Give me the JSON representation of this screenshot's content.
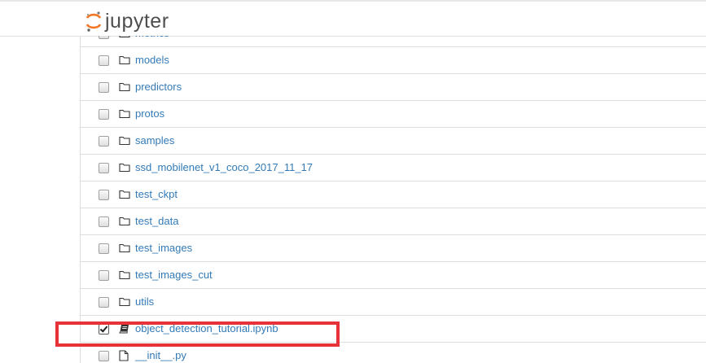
{
  "app": {
    "logo_text": "jupyter"
  },
  "files": [
    {
      "name": "metrics",
      "type": "folder",
      "checked": false
    },
    {
      "name": "models",
      "type": "folder",
      "checked": false
    },
    {
      "name": "predictors",
      "type": "folder",
      "checked": false
    },
    {
      "name": "protos",
      "type": "folder",
      "checked": false
    },
    {
      "name": "samples",
      "type": "folder",
      "checked": false
    },
    {
      "name": "ssd_mobilenet_v1_coco_2017_11_17",
      "type": "folder",
      "checked": false
    },
    {
      "name": "test_ckpt",
      "type": "folder",
      "checked": false
    },
    {
      "name": "test_data",
      "type": "folder",
      "checked": false
    },
    {
      "name": "test_images",
      "type": "folder",
      "checked": false
    },
    {
      "name": "test_images_cut",
      "type": "folder",
      "checked": false
    },
    {
      "name": "utils",
      "type": "folder",
      "checked": false
    },
    {
      "name": "object_detection_tutorial.ipynb",
      "type": "notebook",
      "checked": true
    },
    {
      "name": "__init__.py",
      "type": "file",
      "checked": false
    }
  ],
  "colors": {
    "link": "#337ab7",
    "highlight_border": "#e8323a",
    "logo_orange": "#f37726"
  }
}
